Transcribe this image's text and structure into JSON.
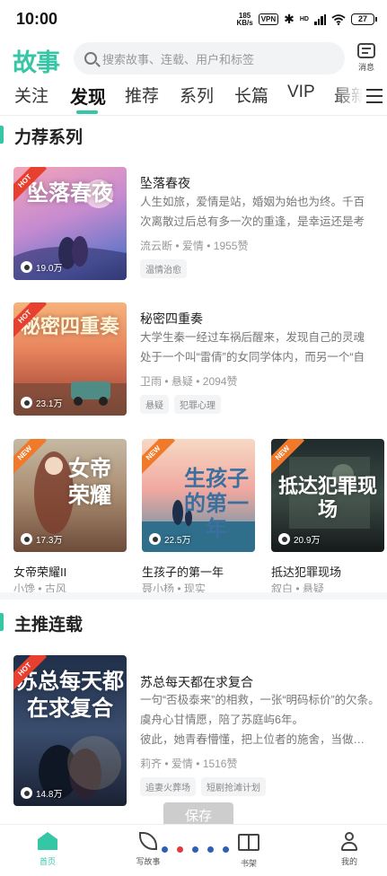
{
  "status_bar": {
    "time": "10:00",
    "net_speed_top": "185",
    "net_speed_bottom": "KB/s",
    "vpn": "VPN",
    "bluetooth": "✱",
    "hd": "HD",
    "battery": "27"
  },
  "header": {
    "logo": "故事",
    "search_placeholder": "搜索故事、连载、用户和标签",
    "message_label": "消息"
  },
  "tabs": [
    {
      "label": "关注"
    },
    {
      "label": "发现"
    },
    {
      "label": "推荐"
    },
    {
      "label": "系列"
    },
    {
      "label": "长篇"
    },
    {
      "label": "VIP"
    },
    {
      "label": "最新"
    }
  ],
  "active_tab_index": 1,
  "section1": {
    "title": "力荐系列",
    "items": [
      {
        "badge": "HOT",
        "cover_title": "坠落春夜",
        "reads": "19.0万",
        "title": "坠落春夜",
        "desc": "人生如旅，爱情是站，婚姻为始也为终。千百次离散过后总有多一次的重逢，是幸运还是考验，是…",
        "author": "流云断",
        "category": "爱情",
        "likes": "1955赞",
        "tags": [
          "温情治愈"
        ]
      },
      {
        "badge": "HOT",
        "cover_title": "秘密四重奏",
        "reads": "23.1万",
        "title": "秘密四重奏",
        "desc": "大学生秦一经过车祸后醒来，发现自己的灵魂处于一个叫“雷倩”的女同学体内，而另一个“自己”正和…",
        "author": "卫雨",
        "category": "悬疑",
        "likes": "2094赞",
        "tags": [
          "悬疑",
          "犯罪心理"
        ]
      }
    ],
    "grid": [
      {
        "badge": "NEW",
        "cover_title": "女帝荣耀",
        "reads": "17.3万",
        "title": "女帝荣耀II",
        "author": "小馋",
        "category": "古风"
      },
      {
        "badge": "NEW",
        "cover_title": "生孩子的第一年",
        "reads": "22.5万",
        "title": "生孩子的第一年",
        "author": "聂小杨",
        "category": "现实"
      },
      {
        "badge": "NEW",
        "cover_title": "抵达犯罪现场",
        "reads": "20.9万",
        "title": "抵达犯罪现场",
        "author": "叙白",
        "category": "悬疑"
      }
    ]
  },
  "section2": {
    "title": "主推连载",
    "items": [
      {
        "badge": "HOT",
        "cover_title": "苏总每天都在求复合",
        "reads": "14.8万",
        "title": "苏总每天都在求复合",
        "desc_lines": [
          "一句“否极泰来”的相救，一张“明码标价”的欠条。",
          "虞舟心甘情愿，陪了苏庭屿6年。",
          "彼此，她青春懵懂，把上位者的施舍，当做隐忍…"
        ],
        "author": "莉齐",
        "category": "爱情",
        "likes": "1516赞",
        "tags": [
          "追妻火葬场",
          "短剧抢滩计划"
        ]
      }
    ]
  },
  "save_button": "保存",
  "bottom_nav": [
    {
      "label": "首页",
      "icon": "home-icon"
    },
    {
      "label": "写故事",
      "icon": "feather-icon"
    },
    {
      "label": "书架",
      "icon": "bookshelf-icon"
    },
    {
      "label": "我的",
      "icon": "user-icon"
    }
  ],
  "colors": {
    "accent": "#35c6a6",
    "hot_badge": "#e8402f",
    "new_badge": "#f07a2a"
  }
}
